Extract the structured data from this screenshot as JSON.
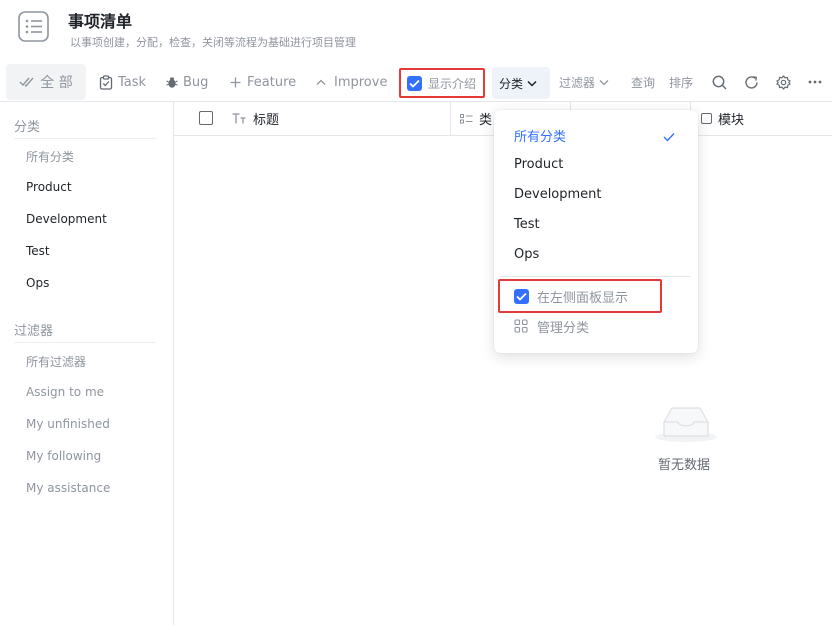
{
  "header": {
    "title": "事项清单",
    "subtitle": "以事项创建，分配，检查，关闭等流程为基础进行项目管理",
    "icon": "list-icon"
  },
  "toolbar": {
    "all_label": "全 部",
    "task_label": "Task",
    "bug_label": "Bug",
    "feature_label": "Feature",
    "improve_label": "Improve",
    "show_intro_label": "显示介绍",
    "show_intro_checked": true,
    "category_label": "分类",
    "filter_label": "过滤器",
    "query_label": "查询",
    "sort_label": "排序"
  },
  "sidebar": {
    "category_heading": "分类",
    "categories": [
      "所有分类",
      "Product",
      "Development",
      "Test",
      "Ops"
    ],
    "filter_heading": "过滤器",
    "filters": [
      "所有过滤器",
      "Assign to me",
      "My unfinished",
      "My following",
      "My assistance"
    ]
  },
  "table": {
    "columns": [
      "标题",
      "类",
      "模块"
    ]
  },
  "empty_state": {
    "text": "暂无数据"
  },
  "category_dropdown": {
    "items": [
      "所有分类",
      "Product",
      "Development",
      "Test",
      "Ops"
    ],
    "selected": "所有分类",
    "show_in_left_panel_label": "在左侧面板显示",
    "show_in_left_panel_checked": true,
    "manage_label": "管理分类"
  },
  "colors": {
    "accent": "#3370ff",
    "highlight_border": "#e5393a",
    "muted_text": "#8f959e"
  }
}
